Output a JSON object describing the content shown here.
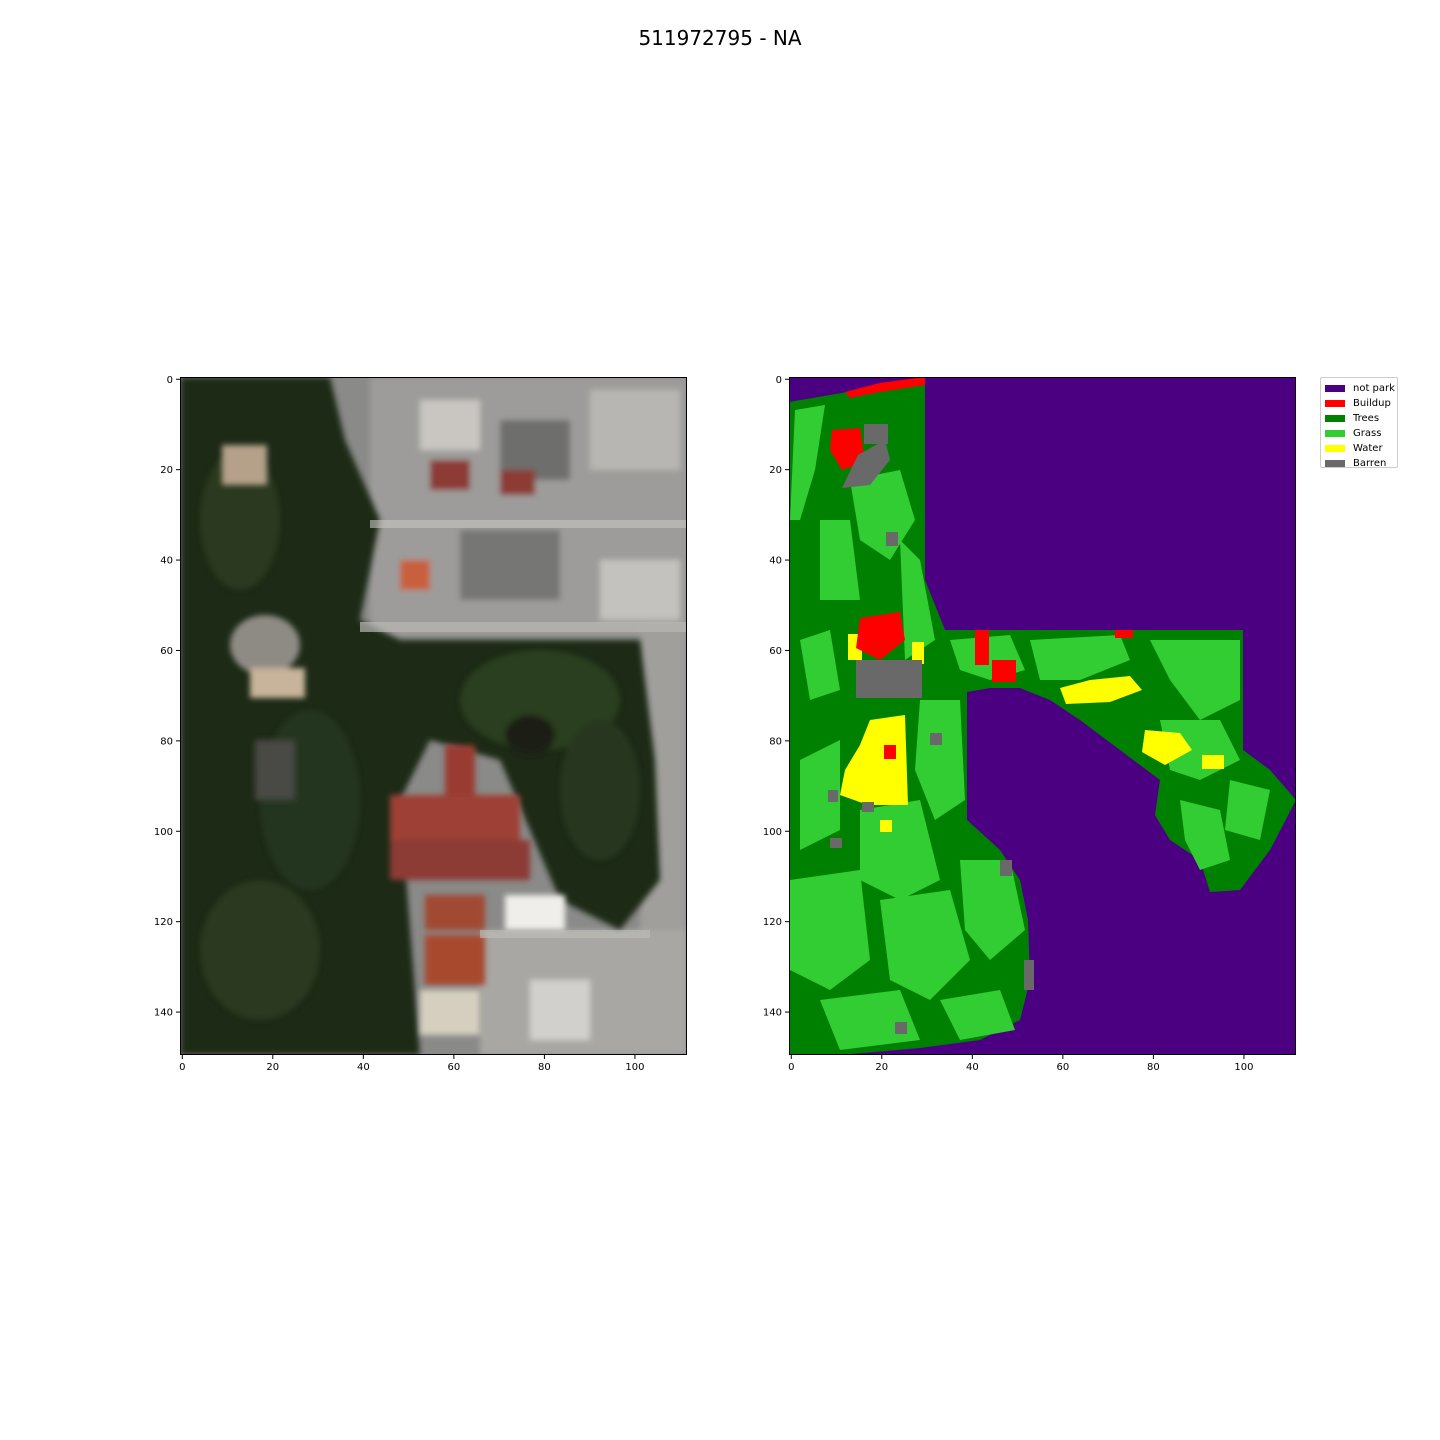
{
  "figure": {
    "title": "511972795 - NA"
  },
  "left_panel": {
    "xticks": [
      0,
      20,
      40,
      60,
      80,
      100
    ],
    "yticks": [
      0,
      20,
      40,
      60,
      80,
      100,
      120,
      140
    ]
  },
  "right_panel": {
    "xticks": [
      0,
      20,
      40,
      60,
      80,
      100
    ],
    "yticks": [
      0,
      20,
      40,
      60,
      80,
      100,
      120,
      140
    ]
  },
  "legend": {
    "items": [
      {
        "label": "not park",
        "color": "#4b0082"
      },
      {
        "label": "Buildup",
        "color": "#ff0000"
      },
      {
        "label": "Trees",
        "color": "#008000"
      },
      {
        "label": "Grass",
        "color": "#32cd32"
      },
      {
        "label": "Water",
        "color": "#ffff00"
      },
      {
        "label": "Barren",
        "color": "#696969"
      }
    ]
  }
}
